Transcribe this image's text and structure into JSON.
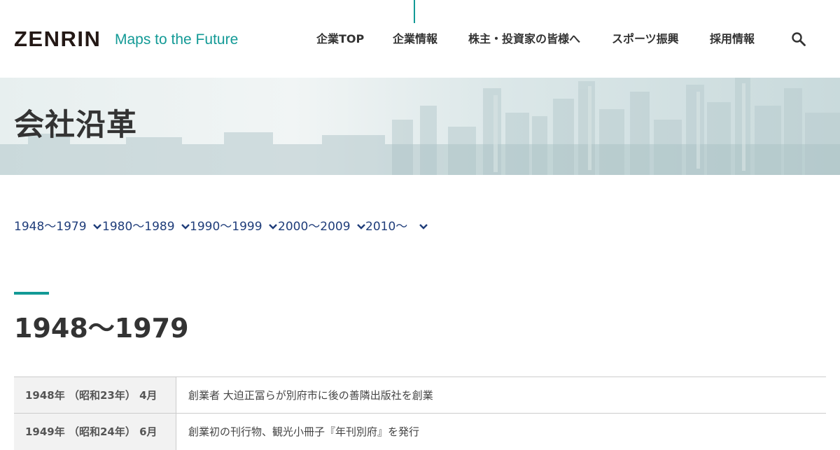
{
  "header": {
    "logo": "ZENRIN",
    "tagline": "Maps to the Future",
    "nav": [
      {
        "label": "企業TOP"
      },
      {
        "label": "企業情報"
      },
      {
        "label": "株主・投資家の皆様へ"
      },
      {
        "label": "スポーツ振興"
      },
      {
        "label": "採用情報"
      }
    ],
    "search_icon": "search-icon"
  },
  "hero": {
    "title": "会社沿革"
  },
  "period_nav": [
    {
      "label": "1948～1979"
    },
    {
      "label": "1980～1989"
    },
    {
      "label": "1990～1999"
    },
    {
      "label": "2000～2009"
    },
    {
      "label": "2010～"
    }
  ],
  "section": {
    "heading": "1948～1979",
    "rows": [
      {
        "date": "1948年 （昭和23年） 4月",
        "event": "創業者 大迫正冨らが別府市に後の善隣出版社を創業"
      },
      {
        "date": "1949年 （昭和24年） 6月",
        "event": "創業初の刊行物、観光小冊子『年刊別府』を発行"
      }
    ]
  },
  "colors": {
    "accent": "#139a96",
    "link": "#1f3d7a",
    "text": "#333333"
  }
}
